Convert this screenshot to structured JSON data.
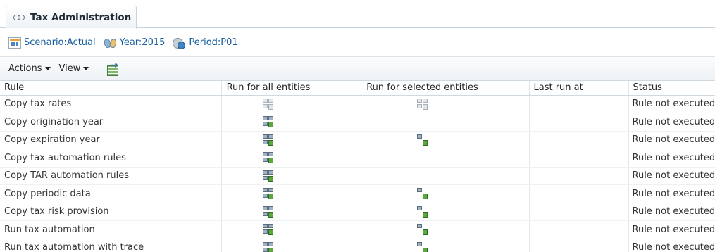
{
  "tab": {
    "title": "Tax Administration",
    "icon": "link-icon"
  },
  "pov": [
    {
      "label": "Scenario:Actual",
      "icon": "scenario-icon"
    },
    {
      "label": "Year:2015",
      "icon": "year-icon"
    },
    {
      "label": "Period:P01",
      "icon": "period-icon"
    }
  ],
  "toolbar": {
    "actions_label": "Actions",
    "view_label": "View",
    "export_icon": "export-to-excel-icon"
  },
  "table": {
    "columns": [
      "Rule",
      "Run for all entities",
      "Run for selected entities",
      "Last run at",
      "Status"
    ],
    "rows": [
      {
        "rule": "Copy tax rates",
        "all": "disabled",
        "selected": "disabled",
        "last_run": "",
        "status": "Rule not executed"
      },
      {
        "rule": "Copy origination year",
        "all": "enabled",
        "selected": "none",
        "last_run": "",
        "status": "Rule not executed"
      },
      {
        "rule": "Copy expiration year",
        "all": "enabled",
        "selected": "enabled",
        "last_run": "",
        "status": "Rule not executed"
      },
      {
        "rule": "Copy tax automation rules",
        "all": "enabled",
        "selected": "none",
        "last_run": "",
        "status": "Rule not executed"
      },
      {
        "rule": "Copy TAR automation rules",
        "all": "enabled",
        "selected": "none",
        "last_run": "",
        "status": "Rule not executed"
      },
      {
        "rule": "Copy periodic data",
        "all": "enabled",
        "selected": "enabled",
        "last_run": "",
        "status": "Rule not executed"
      },
      {
        "rule": "Copy tax risk provision",
        "all": "enabled",
        "selected": "enabled",
        "last_run": "",
        "status": "Rule not executed"
      },
      {
        "rule": "Run tax automation",
        "all": "enabled",
        "selected": "enabled",
        "last_run": "",
        "status": "Rule not executed"
      },
      {
        "rule": "Run tax automation with trace",
        "all": "enabled",
        "selected": "enabled",
        "last_run": "",
        "status": "Rule not executed"
      }
    ]
  }
}
